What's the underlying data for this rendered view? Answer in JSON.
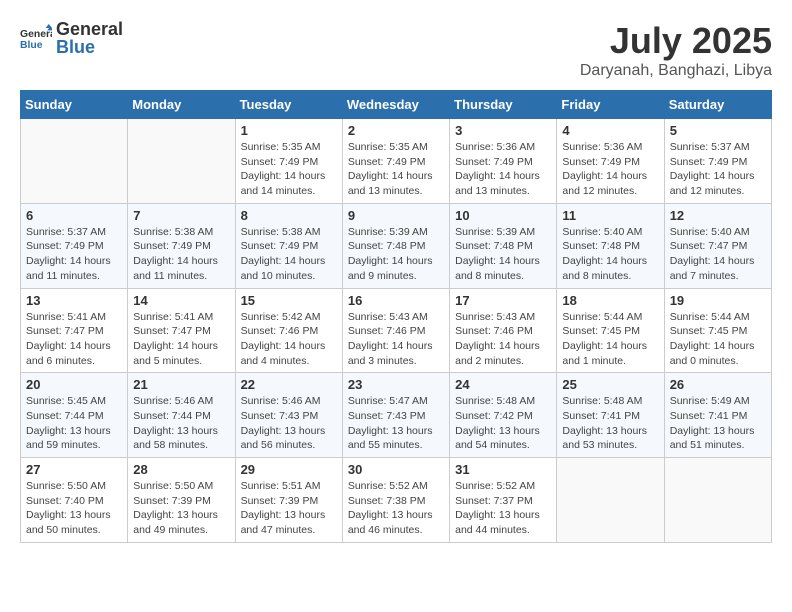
{
  "header": {
    "logo_general": "General",
    "logo_blue": "Blue",
    "month": "July 2025",
    "location": "Daryanah, Banghazi, Libya"
  },
  "weekdays": [
    "Sunday",
    "Monday",
    "Tuesday",
    "Wednesday",
    "Thursday",
    "Friday",
    "Saturday"
  ],
  "weeks": [
    [
      {
        "day": "",
        "sunrise": "",
        "sunset": "",
        "daylight": ""
      },
      {
        "day": "",
        "sunrise": "",
        "sunset": "",
        "daylight": ""
      },
      {
        "day": "1",
        "sunrise": "Sunrise: 5:35 AM",
        "sunset": "Sunset: 7:49 PM",
        "daylight": "Daylight: 14 hours and 14 minutes."
      },
      {
        "day": "2",
        "sunrise": "Sunrise: 5:35 AM",
        "sunset": "Sunset: 7:49 PM",
        "daylight": "Daylight: 14 hours and 13 minutes."
      },
      {
        "day": "3",
        "sunrise": "Sunrise: 5:36 AM",
        "sunset": "Sunset: 7:49 PM",
        "daylight": "Daylight: 14 hours and 13 minutes."
      },
      {
        "day": "4",
        "sunrise": "Sunrise: 5:36 AM",
        "sunset": "Sunset: 7:49 PM",
        "daylight": "Daylight: 14 hours and 12 minutes."
      },
      {
        "day": "5",
        "sunrise": "Sunrise: 5:37 AM",
        "sunset": "Sunset: 7:49 PM",
        "daylight": "Daylight: 14 hours and 12 minutes."
      }
    ],
    [
      {
        "day": "6",
        "sunrise": "Sunrise: 5:37 AM",
        "sunset": "Sunset: 7:49 PM",
        "daylight": "Daylight: 14 hours and 11 minutes."
      },
      {
        "day": "7",
        "sunrise": "Sunrise: 5:38 AM",
        "sunset": "Sunset: 7:49 PM",
        "daylight": "Daylight: 14 hours and 11 minutes."
      },
      {
        "day": "8",
        "sunrise": "Sunrise: 5:38 AM",
        "sunset": "Sunset: 7:49 PM",
        "daylight": "Daylight: 14 hours and 10 minutes."
      },
      {
        "day": "9",
        "sunrise": "Sunrise: 5:39 AM",
        "sunset": "Sunset: 7:48 PM",
        "daylight": "Daylight: 14 hours and 9 minutes."
      },
      {
        "day": "10",
        "sunrise": "Sunrise: 5:39 AM",
        "sunset": "Sunset: 7:48 PM",
        "daylight": "Daylight: 14 hours and 8 minutes."
      },
      {
        "day": "11",
        "sunrise": "Sunrise: 5:40 AM",
        "sunset": "Sunset: 7:48 PM",
        "daylight": "Daylight: 14 hours and 8 minutes."
      },
      {
        "day": "12",
        "sunrise": "Sunrise: 5:40 AM",
        "sunset": "Sunset: 7:47 PM",
        "daylight": "Daylight: 14 hours and 7 minutes."
      }
    ],
    [
      {
        "day": "13",
        "sunrise": "Sunrise: 5:41 AM",
        "sunset": "Sunset: 7:47 PM",
        "daylight": "Daylight: 14 hours and 6 minutes."
      },
      {
        "day": "14",
        "sunrise": "Sunrise: 5:41 AM",
        "sunset": "Sunset: 7:47 PM",
        "daylight": "Daylight: 14 hours and 5 minutes."
      },
      {
        "day": "15",
        "sunrise": "Sunrise: 5:42 AM",
        "sunset": "Sunset: 7:46 PM",
        "daylight": "Daylight: 14 hours and 4 minutes."
      },
      {
        "day": "16",
        "sunrise": "Sunrise: 5:43 AM",
        "sunset": "Sunset: 7:46 PM",
        "daylight": "Daylight: 14 hours and 3 minutes."
      },
      {
        "day": "17",
        "sunrise": "Sunrise: 5:43 AM",
        "sunset": "Sunset: 7:46 PM",
        "daylight": "Daylight: 14 hours and 2 minutes."
      },
      {
        "day": "18",
        "sunrise": "Sunrise: 5:44 AM",
        "sunset": "Sunset: 7:45 PM",
        "daylight": "Daylight: 14 hours and 1 minute."
      },
      {
        "day": "19",
        "sunrise": "Sunrise: 5:44 AM",
        "sunset": "Sunset: 7:45 PM",
        "daylight": "Daylight: 14 hours and 0 minutes."
      }
    ],
    [
      {
        "day": "20",
        "sunrise": "Sunrise: 5:45 AM",
        "sunset": "Sunset: 7:44 PM",
        "daylight": "Daylight: 13 hours and 59 minutes."
      },
      {
        "day": "21",
        "sunrise": "Sunrise: 5:46 AM",
        "sunset": "Sunset: 7:44 PM",
        "daylight": "Daylight: 13 hours and 58 minutes."
      },
      {
        "day": "22",
        "sunrise": "Sunrise: 5:46 AM",
        "sunset": "Sunset: 7:43 PM",
        "daylight": "Daylight: 13 hours and 56 minutes."
      },
      {
        "day": "23",
        "sunrise": "Sunrise: 5:47 AM",
        "sunset": "Sunset: 7:43 PM",
        "daylight": "Daylight: 13 hours and 55 minutes."
      },
      {
        "day": "24",
        "sunrise": "Sunrise: 5:48 AM",
        "sunset": "Sunset: 7:42 PM",
        "daylight": "Daylight: 13 hours and 54 minutes."
      },
      {
        "day": "25",
        "sunrise": "Sunrise: 5:48 AM",
        "sunset": "Sunset: 7:41 PM",
        "daylight": "Daylight: 13 hours and 53 minutes."
      },
      {
        "day": "26",
        "sunrise": "Sunrise: 5:49 AM",
        "sunset": "Sunset: 7:41 PM",
        "daylight": "Daylight: 13 hours and 51 minutes."
      }
    ],
    [
      {
        "day": "27",
        "sunrise": "Sunrise: 5:50 AM",
        "sunset": "Sunset: 7:40 PM",
        "daylight": "Daylight: 13 hours and 50 minutes."
      },
      {
        "day": "28",
        "sunrise": "Sunrise: 5:50 AM",
        "sunset": "Sunset: 7:39 PM",
        "daylight": "Daylight: 13 hours and 49 minutes."
      },
      {
        "day": "29",
        "sunrise": "Sunrise: 5:51 AM",
        "sunset": "Sunset: 7:39 PM",
        "daylight": "Daylight: 13 hours and 47 minutes."
      },
      {
        "day": "30",
        "sunrise": "Sunrise: 5:52 AM",
        "sunset": "Sunset: 7:38 PM",
        "daylight": "Daylight: 13 hours and 46 minutes."
      },
      {
        "day": "31",
        "sunrise": "Sunrise: 5:52 AM",
        "sunset": "Sunset: 7:37 PM",
        "daylight": "Daylight: 13 hours and 44 minutes."
      },
      {
        "day": "",
        "sunrise": "",
        "sunset": "",
        "daylight": ""
      },
      {
        "day": "",
        "sunrise": "",
        "sunset": "",
        "daylight": ""
      }
    ]
  ]
}
